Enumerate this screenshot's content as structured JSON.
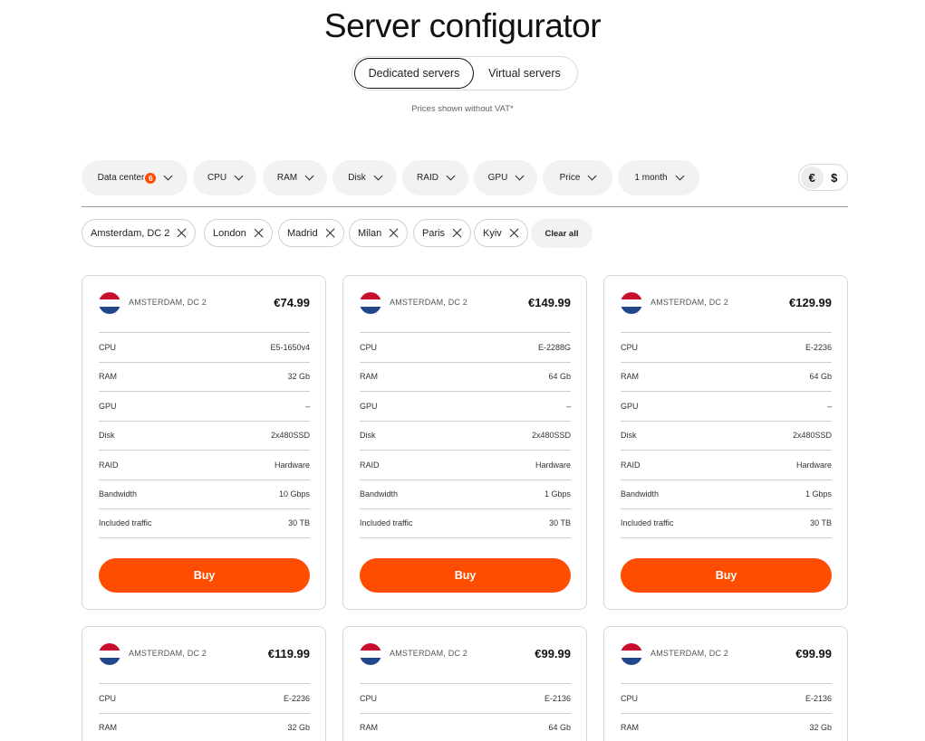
{
  "title": "Server configurator",
  "tabs": [
    {
      "label": "Dedicated servers",
      "active": true
    },
    {
      "label": "Virtual servers",
      "active": false
    }
  ],
  "vat_note": "Prices shown without VAT*",
  "filters": {
    "datacenter": {
      "label": "Data center",
      "badge": "6"
    },
    "cpu": "CPU",
    "ram": "RAM",
    "disk": "Disk",
    "raid": "RAID",
    "gpu": "GPU",
    "price": "Price",
    "period": "1 month"
  },
  "currency": {
    "euro": "€",
    "dollar": "$",
    "selected": "euro"
  },
  "chips": [
    "Amsterdam, DC 2",
    "London",
    "Madrid",
    "Milan",
    "Paris",
    "Kyiv"
  ],
  "clear_all": "Clear all",
  "spec_labels": {
    "cpu": "CPU",
    "ram": "RAM",
    "gpu": "GPU",
    "disk": "Disk",
    "raid": "RAID",
    "bandwidth": "Bandwidth",
    "traffic": "Included traffic"
  },
  "buy_label": "Buy",
  "colors": {
    "accent": "#ff4d00"
  },
  "cards": [
    {
      "location": "AMSTERDAM, DC 2",
      "price": "€74.99",
      "cpu": "E5-1650v4",
      "ram": "32 Gb",
      "gpu": "–",
      "disk": "2x480SSD",
      "raid": "Hardware",
      "bandwidth": "10 Gbps",
      "traffic": "30 TB"
    },
    {
      "location": "AMSTERDAM, DC 2",
      "price": "€149.99",
      "cpu": "E-2288G",
      "ram": "64 Gb",
      "gpu": "–",
      "disk": "2x480SSD",
      "raid": "Hardware",
      "bandwidth": "1 Gbps",
      "traffic": "30 TB"
    },
    {
      "location": "AMSTERDAM, DC 2",
      "price": "€129.99",
      "cpu": "E-2236",
      "ram": "64 Gb",
      "gpu": "–",
      "disk": "2x480SSD",
      "raid": "Hardware",
      "bandwidth": "1 Gbps",
      "traffic": "30 TB"
    },
    {
      "location": "AMSTERDAM, DC 2",
      "price": "€119.99",
      "cpu": "E-2236",
      "ram": "32 Gb"
    },
    {
      "location": "AMSTERDAM, DC 2",
      "price": "€99.99",
      "cpu": "E-2136",
      "ram": "64 Gb"
    },
    {
      "location": "AMSTERDAM, DC 2",
      "price": "€99.99",
      "cpu": "E-2136",
      "ram": "32 Gb"
    }
  ]
}
